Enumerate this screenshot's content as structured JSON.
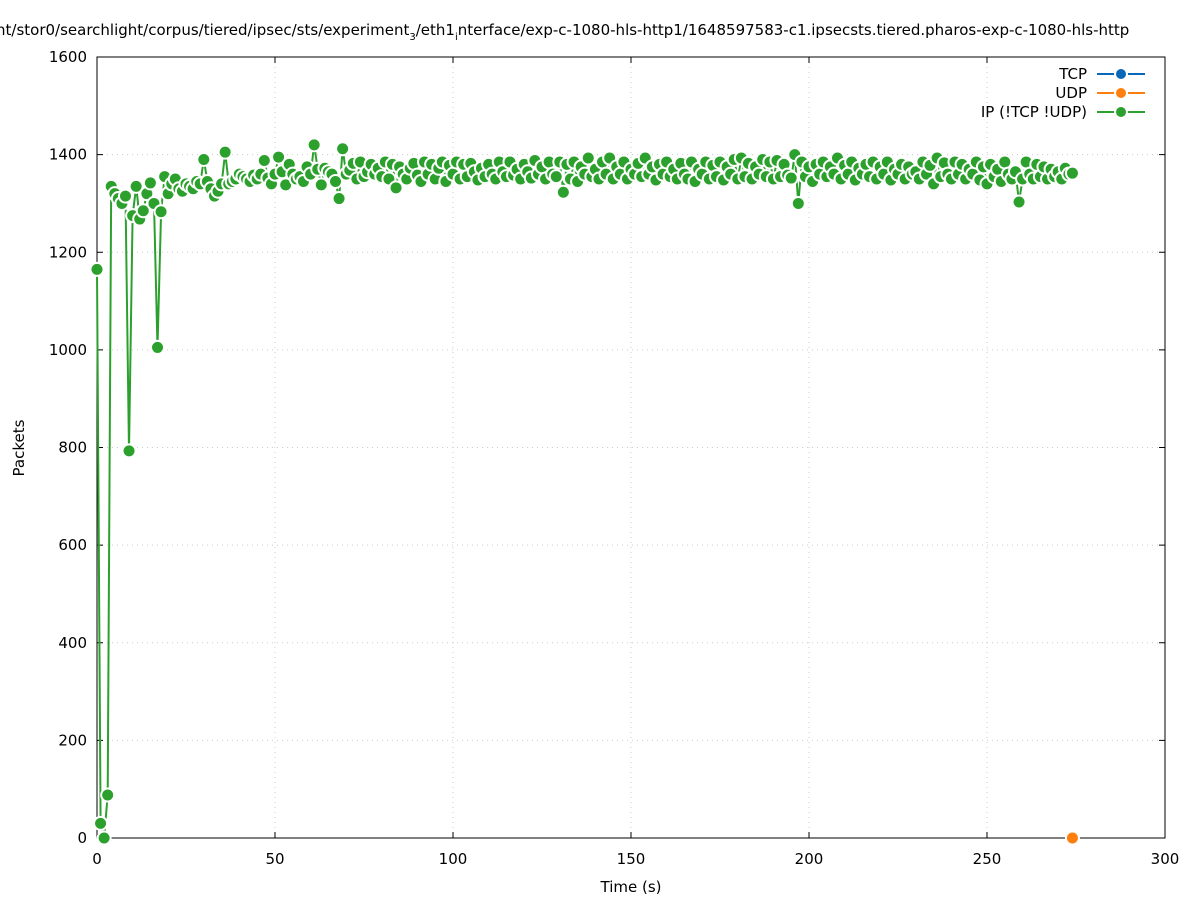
{
  "chart_data": {
    "type": "line",
    "title_parts": [
      "nt/stor0/searchlight/corpus/tiered/ipsec/sts/experiment",
      "3",
      "/eth1",
      "i",
      "nterface/exp-c-1080-hls-http1/1648597583-c1.ipsecsts.tiered.pharos-exp-c-1080-hls-http"
    ],
    "xlabel": "Time (s)",
    "ylabel": "Packets",
    "xlim": [
      0,
      300
    ],
    "ylim": [
      0,
      1600
    ],
    "xticks": [
      0,
      50,
      100,
      150,
      200,
      250,
      300
    ],
    "yticks": [
      0,
      200,
      400,
      600,
      800,
      1000,
      1200,
      1400,
      1600
    ],
    "grid": true,
    "legend_position": "top-right",
    "series": [
      {
        "name": "TCP",
        "color": "#0b67b8",
        "x": [],
        "values": []
      },
      {
        "name": "UDP",
        "color": "#ff7f0e",
        "x": [
          274
        ],
        "values": [
          0
        ]
      },
      {
        "name": "IP (!TCP  !UDP)",
        "color": "#2ca02c",
        "x_start": 0,
        "x_step": 1,
        "values": [
          1165,
          30,
          0,
          88,
          1335,
          1320,
          1310,
          1300,
          1315,
          793,
          1275,
          1335,
          1268,
          1285,
          1320,
          1342,
          1300,
          1005,
          1283,
          1355,
          1320,
          1340,
          1350,
          1330,
          1325,
          1340,
          1335,
          1330,
          1345,
          1340,
          1390,
          1345,
          1330,
          1315,
          1325,
          1340,
          1405,
          1340,
          1345,
          1350,
          1360,
          1355,
          1350,
          1345,
          1358,
          1350,
          1360,
          1388,
          1352,
          1340,
          1360,
          1395,
          1365,
          1338,
          1380,
          1360,
          1350,
          1355,
          1345,
          1375,
          1360,
          1420,
          1370,
          1338,
          1372,
          1365,
          1360,
          1345,
          1310,
          1412,
          1360,
          1368,
          1382,
          1350,
          1385,
          1355,
          1365,
          1380,
          1360,
          1372,
          1355,
          1385,
          1350,
          1380,
          1332,
          1375,
          1360,
          1350,
          1372,
          1382,
          1358,
          1345,
          1385,
          1360,
          1380,
          1350,
          1372,
          1385,
          1345,
          1378,
          1360,
          1385,
          1350,
          1380,
          1355,
          1382,
          1365,
          1348,
          1372,
          1355,
          1380,
          1360,
          1350,
          1385,
          1365,
          1355,
          1385,
          1358,
          1370,
          1350,
          1380,
          1365,
          1352,
          1388,
          1360,
          1375,
          1350,
          1385,
          1360,
          1355,
          1385,
          1323,
          1380,
          1350,
          1385,
          1345,
          1375,
          1360,
          1393,
          1355,
          1370,
          1350,
          1385,
          1360,
          1393,
          1350,
          1375,
          1360,
          1385,
          1350,
          1370,
          1360,
          1382,
          1355,
          1393,
          1360,
          1375,
          1348,
          1380,
          1360,
          1385,
          1355,
          1370,
          1350,
          1382,
          1360,
          1350,
          1385,
          1345,
          1370,
          1360,
          1385,
          1350,
          1378,
          1355,
          1385,
          1348,
          1375,
          1360,
          1390,
          1350,
          1393,
          1355,
          1382,
          1350,
          1375,
          1360,
          1390,
          1355,
          1385,
          1350,
          1388,
          1355,
          1380,
          1358,
          1352,
          1400,
          1300,
          1385,
          1355,
          1375,
          1345,
          1380,
          1360,
          1385,
          1355,
          1375,
          1360,
          1393,
          1350,
          1378,
          1360,
          1385,
          1348,
          1372,
          1360,
          1380,
          1355,
          1385,
          1350,
          1375,
          1360,
          1385,
          1348,
          1370,
          1360,
          1380,
          1350,
          1375,
          1360,
          1365,
          1350,
          1385,
          1360,
          1378,
          1340,
          1393,
          1355,
          1383,
          1360,
          1350,
          1385,
          1360,
          1380,
          1350,
          1370,
          1360,
          1385,
          1348,
          1375,
          1340,
          1380,
          1355,
          1370,
          1345,
          1385,
          1360,
          1350,
          1365,
          1303,
          1350,
          1385,
          1360,
          1350,
          1380,
          1355,
          1375,
          1350,
          1370,
          1355,
          1365,
          1350,
          1372,
          1360,
          1362
        ]
      }
    ]
  }
}
